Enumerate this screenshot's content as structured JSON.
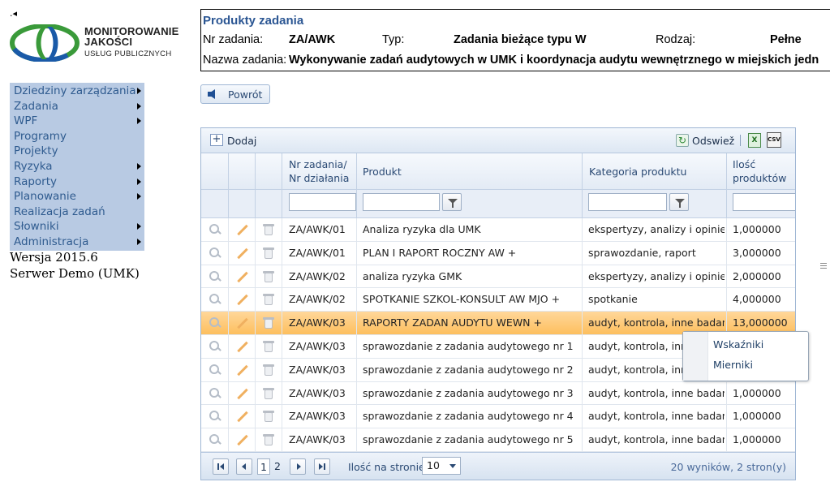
{
  "logo": {
    "line1": "MONITOROWANIE",
    "line2": "JAKOŚCI",
    "line3": "USŁUG PUBLICZNYCH"
  },
  "menu": [
    {
      "label": "Dziedziny zarządzania",
      "submenu": true
    },
    {
      "label": "Zadania",
      "submenu": true
    },
    {
      "label": "WPF",
      "submenu": true
    },
    {
      "label": "Programy",
      "submenu": false
    },
    {
      "label": "Projekty",
      "submenu": false
    },
    {
      "label": "Ryzyka",
      "submenu": true
    },
    {
      "label": "Raporty",
      "submenu": true
    },
    {
      "label": "Planowanie",
      "submenu": true
    },
    {
      "label": "Realizacja zadań",
      "submenu": false
    },
    {
      "label": "Słowniki",
      "submenu": true
    },
    {
      "label": "Administracja",
      "submenu": true
    }
  ],
  "version": {
    "line1": "Wersja 2015.6",
    "line2": "Serwer Demo (UMK)"
  },
  "header": {
    "title": "Produkty zadania",
    "nr_label": "Nr zadania:",
    "nr_value": "ZA/AWK",
    "typ_label": "Typ:",
    "typ_value": "Zadania bieżące typu W",
    "rodzaj_label": "Rodzaj:",
    "rodzaj_value": "Pełne",
    "nazwa_label": "Nazwa zadania:",
    "nazwa_value": "Wykonywanie zadań audytowych w UMK i koordynacja audytu wewnętrznego w miejskich jedn"
  },
  "back_button": "Powrót",
  "toolbar": {
    "add": "Dodaj",
    "refresh": "Odswiež",
    "xls_icon": "excel-icon",
    "csv_icon": "csv-icon"
  },
  "columns": {
    "nr": [
      "Nr zadania/",
      "Nr działania"
    ],
    "produkt": "Produkt",
    "kategoria": "Kategoria produktu",
    "ilosc": [
      "Ilość",
      "produktów"
    ]
  },
  "rows": [
    {
      "nr": "ZA/AWK/01",
      "produkt": "Analiza ryzyka dla UMK",
      "kategoria": "ekspertyzy, analizy i opinie",
      "ilosc": "1,000000"
    },
    {
      "nr": "ZA/AWK/01",
      "produkt": "PLAN I RAPORT ROCZNY AW +",
      "kategoria": "sprawozdanie, raport",
      "ilosc": "3,000000"
    },
    {
      "nr": "ZA/AWK/02",
      "produkt": "analiza ryzyka GMK",
      "kategoria": "ekspertyzy, analizy i opinie",
      "ilosc": "2,000000"
    },
    {
      "nr": "ZA/AWK/02",
      "produkt": "SPOTKANIE SZKOL-KONSULT AW MJO +",
      "kategoria": "spotkanie",
      "ilosc": "4,000000"
    },
    {
      "nr": "ZA/AWK/03",
      "produkt": "RAPORTY ZADAN AUDYTU WEWN +",
      "kategoria": "audyt, kontrola, inne badania",
      "ilosc": "13,000000",
      "selected": true
    },
    {
      "nr": "ZA/AWK/03",
      "produkt": "sprawozdanie z zadania audytowego nr 1",
      "kategoria": "audyt, kontrola, inne badania",
      "ilosc": ""
    },
    {
      "nr": "ZA/AWK/03",
      "produkt": "sprawozdanie z zadania audytowego nr 2",
      "kategoria": "audyt, kontrola, inne badania",
      "ilosc": ""
    },
    {
      "nr": "ZA/AWK/03",
      "produkt": "sprawozdanie z zadania audytowego nr 3",
      "kategoria": "audyt, kontrola, inne badania",
      "ilosc": "1,000000"
    },
    {
      "nr": "ZA/AWK/03",
      "produkt": "sprawozdanie z zadania audytowego nr 4",
      "kategoria": "audyt, kontrola, inne badania",
      "ilosc": "1,000000"
    },
    {
      "nr": "ZA/AWK/03",
      "produkt": "sprawozdanie z zadania audytowego nr 5",
      "kategoria": "audyt, kontrola, inne badania",
      "ilosc": "1,000000"
    }
  ],
  "context_menu": [
    "Wskaźniki",
    "Mierniki"
  ],
  "pager": {
    "pages": [
      "1",
      "2"
    ],
    "current": "1",
    "page_size_label": "Ilość na stronie:",
    "page_size": "10",
    "info": "20 wyników, 2 stron(y)"
  },
  "colors": {
    "menu_bg": "#b8cae3",
    "menu_text": "#2f5b8f",
    "title": "#2b5693",
    "selected_row": "#fdbf5e",
    "logo_green": "#3a9a3a",
    "logo_blue": "#1a5aa8"
  }
}
